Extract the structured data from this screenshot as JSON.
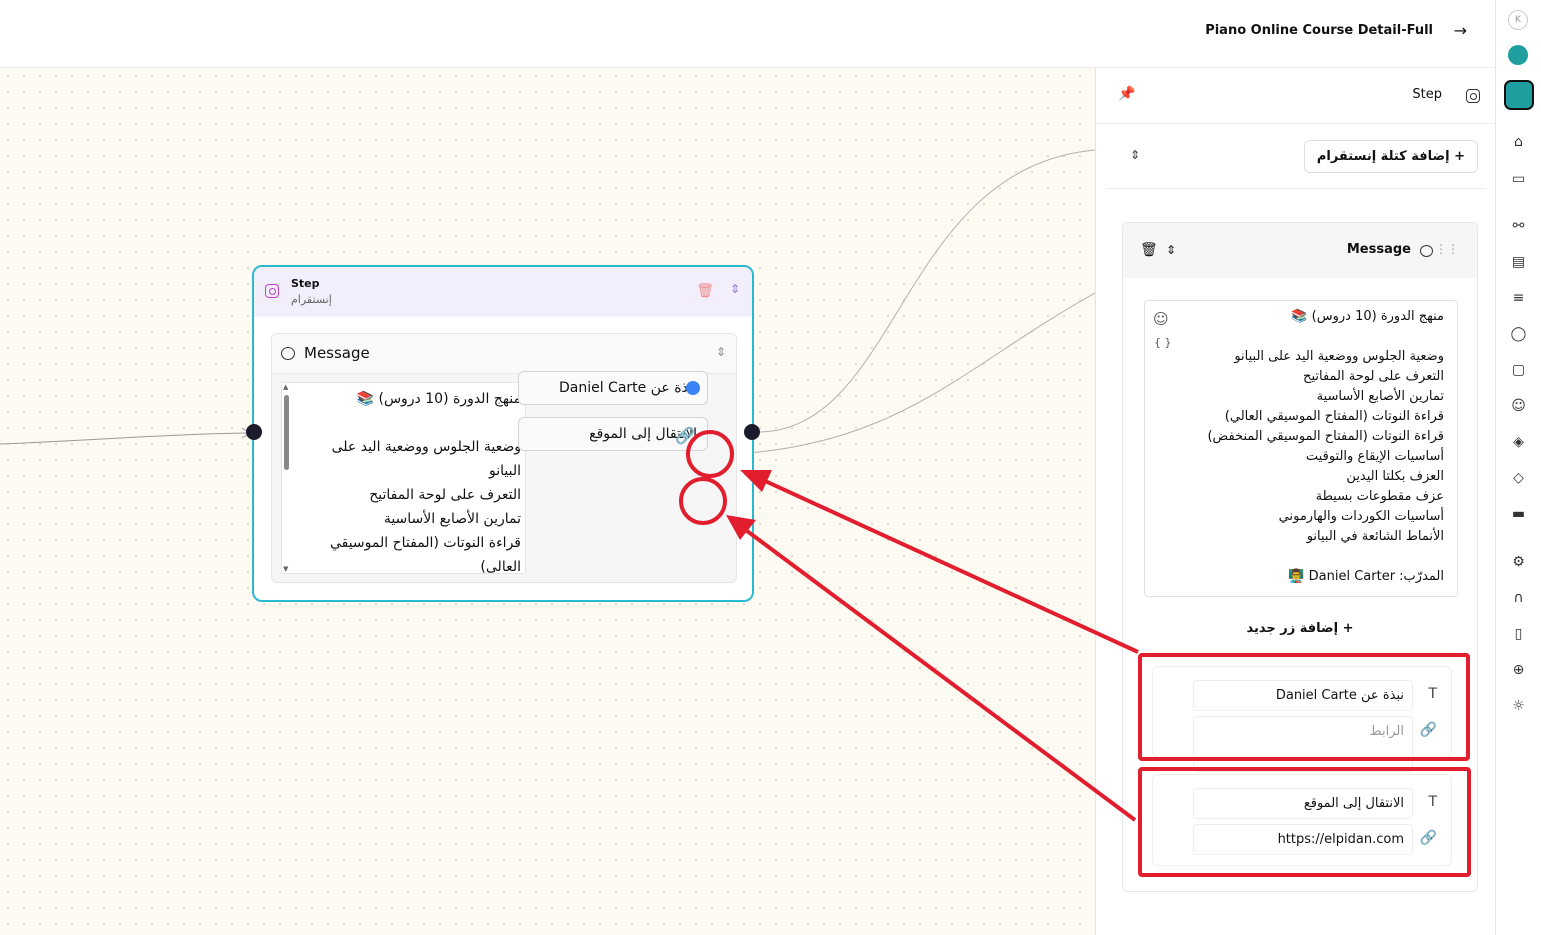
{
  "topbar": {
    "title": "Piano Online Course Detail-Full",
    "arrow_icon": "arrow-right-icon"
  },
  "node": {
    "title": "Step",
    "subtitle": "إنستقرام",
    "message_label": "Message",
    "text_lines": [
      "منهج الدورة (10 دروس) 📚",
      "",
      "وضعية الجلوس ووضعية اليد على البيانو",
      "التعرف على لوحة المفاتيح",
      "تمارين الأصابع الأساسية",
      "قراءة النوتات (المفتاح الموسيقي العالي)"
    ],
    "button1": "نبذة عن Daniel Carte",
    "button2": "الانتقال إلى الموقع"
  },
  "panel": {
    "header_label": "Step",
    "add_block_label": "إضافة كتلة إنستقرام",
    "message_label": "Message",
    "text_lines": [
      "منهج الدورة (10 دروس) 📚",
      "",
      "وضعية الجلوس ووضعية اليد على البيانو",
      "التعرف على لوحة المفاتيح",
      "تمارين الأصابع الأساسية",
      "قراءة النوتات (المفتاح الموسيقي العالي)",
      "قراءة النوتات (المفتاح الموسيقي المنخفض)",
      "أساسيات الإيقاع والتوقيت",
      "العزف بكلتا اليدين",
      "عزف مقطوعات بسيطة",
      "أساسيات الكوردات والهارموني",
      "الأنماط الشائعة في البيانو",
      "",
      "المدرّب: Daniel Carter 👨‍🏫"
    ],
    "add_button_label": "إضافة زر جديد",
    "buttons": [
      {
        "text": "نبذة عن Daniel Carte",
        "link_value": "",
        "link_placeholder": "الرابط"
      },
      {
        "text": "الانتقال إلى الموقع",
        "link_value": "https://elpidan.com",
        "link_placeholder": ""
      }
    ]
  },
  "colors": {
    "accent_cyan": "#2bb9cf",
    "highlight_red": "#e11d2e",
    "link_blue": "#3b82f6",
    "brand_teal": "#1f9ea0"
  },
  "sidebar_icons": [
    "home-icon",
    "inbox-icon",
    "flow-icon",
    "layout-icon",
    "list-icon",
    "chat-icon",
    "message-icon",
    "users-icon",
    "box-icon",
    "tag-icon",
    "ticket-icon",
    "settings-icon",
    "headset-icon",
    "book-icon",
    "globe-icon",
    "sun-icon"
  ]
}
